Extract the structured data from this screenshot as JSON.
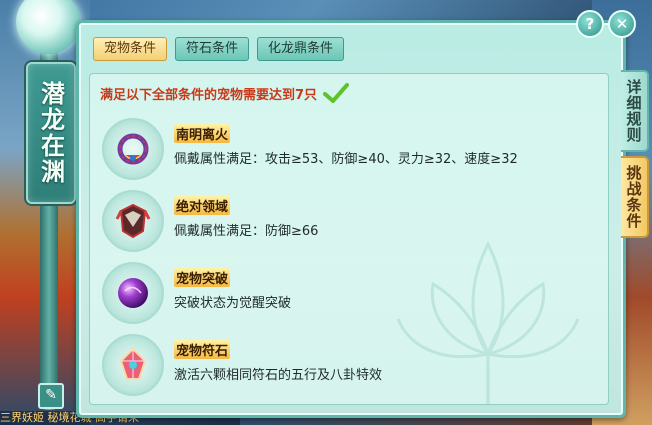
{
  "window": {
    "title": "潜龙在渊",
    "help_label": "?",
    "close_label": "✕"
  },
  "tabs": [
    {
      "label": "宠物条件",
      "active": true
    },
    {
      "label": "符石条件",
      "active": false
    },
    {
      "label": "化龙鼎条件",
      "active": false
    }
  ],
  "side_tabs": [
    {
      "label": "详细规则",
      "active": false
    },
    {
      "label": "挑战条件",
      "active": true
    }
  ],
  "headline": "满足以下全部条件的宠物需要达到7只",
  "conditions": [
    {
      "title": "南明离火",
      "desc": "佩戴属性满足：攻击≥53、防御≥40、灵力≥32、速度≥32",
      "icon": "necklace-icon"
    },
    {
      "title": "绝对领域",
      "desc": "佩戴属性满足：防御≥66",
      "icon": "armor-icon"
    },
    {
      "title": "宠物突破",
      "desc": "突破状态为觉醒突破",
      "icon": "purple-orb-icon"
    },
    {
      "title": "宠物符石",
      "desc": "激活六颗相同符石的五行及八卦特效",
      "icon": "rune-stone-icon"
    }
  ],
  "background_text": "三界妖姬 秘境花城 高手请来",
  "colors": {
    "headline": "#c83a1a",
    "panel": "#b9ece4",
    "active_tab": "#f4cf74"
  }
}
